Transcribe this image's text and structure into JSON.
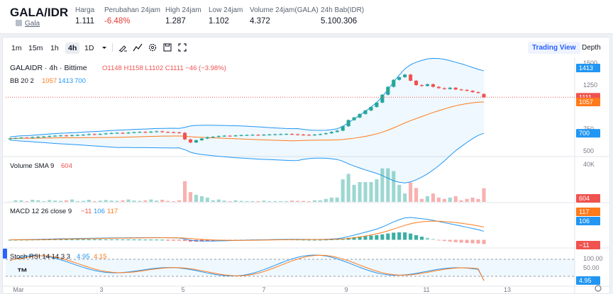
{
  "header": {
    "pair": "GALA/IDR",
    "coin_link": "Gala",
    "stats": [
      {
        "label": "Harga",
        "value": "1.111",
        "neg": false
      },
      {
        "label": "Perubahan 24jam",
        "value": "-6.48%",
        "neg": true
      },
      {
        "label": "High 24jam",
        "value": "1.287",
        "neg": false
      },
      {
        "label": "Low 24jam",
        "value": "1.102",
        "neg": false
      },
      {
        "label": "Volume 24jam(GALA)",
        "value": "4.372",
        "neg": false
      },
      {
        "label": "24h Bab(IDR)",
        "value": "5.100.306",
        "neg": false
      }
    ]
  },
  "toolbar": {
    "timeframes": [
      "1m",
      "15m",
      "1h",
      "4h",
      "1D"
    ],
    "active_timeframe": "4h",
    "icons": [
      "dropdown-icon",
      "draw-icon",
      "indicators-icon",
      "settings-icon",
      "save-icon",
      "fullscreen-icon"
    ],
    "tabs": [
      "Trading View",
      "Depth"
    ],
    "active_tab": "Trading View"
  },
  "legend": {
    "symbol": "GALAIDR · 4h · Bittime",
    "ohlc": "O1148 H1158 L1102 C1111 −46 (−3.98%)",
    "bb_label": "BB 20 2",
    "bb_values": [
      "1057",
      "1413",
      "700"
    ],
    "volume_label": "Volume SMA 9",
    "volume_value": "604",
    "macd_label": "MACD 12 26 close 9",
    "macd_values": [
      "−11",
      "106",
      "117"
    ],
    "stoch_label": "Stoch RSI 14 14 3 3",
    "stoch_values": [
      "4.95",
      "4.15"
    ]
  },
  "axes": {
    "price_ticks": [
      "1500",
      "1250",
      "750",
      "500"
    ],
    "price_badges": [
      {
        "text": "1413",
        "color": "#2196f3"
      },
      {
        "text": "1111",
        "color": "#ef5350"
      },
      {
        "text": "1057",
        "color": "#ff7a1a"
      },
      {
        "text": "700",
        "color": "#2196f3"
      }
    ],
    "volume_ticks": [
      "40K"
    ],
    "volume_badge": "604",
    "macd_badges": [
      {
        "text": "117",
        "color": "#ff7a1a"
      },
      {
        "text": "106",
        "color": "#2196f3"
      },
      {
        "text": "−11",
        "color": "#ef5350"
      }
    ],
    "stoch_ticks": [
      "100.00",
      "50.00"
    ],
    "stoch_badge": "4.95",
    "time_ticks": [
      "Mar",
      "3",
      "5",
      "7",
      "9",
      "11",
      "13"
    ]
  },
  "colors": {
    "up": "#26a69a",
    "down": "#ef5350",
    "bb_mid": "#ff7a1a",
    "bb_band": "#2196f3",
    "stoch_k": "#2196f3",
    "stoch_d": "#ff7a1a"
  },
  "chart_data": {
    "type": "candlestick",
    "symbol": "GALAIDR",
    "interval": "4h",
    "last_candle": {
      "open": 1148,
      "high": 1158,
      "low": 1102,
      "close": 1111,
      "change": -46,
      "change_pct": -3.98
    },
    "closes": [
      640,
      645,
      650,
      648,
      655,
      660,
      662,
      668,
      672,
      675,
      670,
      678,
      680,
      683,
      690,
      688,
      692,
      698,
      702,
      705,
      700,
      708,
      712,
      715,
      710,
      718,
      722,
      715,
      712,
      710,
      705,
      630,
      595,
      620,
      640,
      655,
      660,
      668,
      672,
      670,
      675,
      678,
      680,
      682,
      680,
      684,
      686,
      688,
      690,
      692,
      688,
      685,
      682,
      680,
      685,
      690,
      700,
      715,
      730,
      780,
      850,
      880,
      920,
      960,
      1000,
      1050,
      1140,
      1230,
      1310,
      1340,
      1370,
      1300,
      1250,
      1240,
      1260,
      1230,
      1215,
      1205,
      1220,
      1200,
      1195,
      1185,
      1170,
      1160,
      1111
    ],
    "bb_mid_last": 1057,
    "bb_upper_last": 1413,
    "bb_lower_last": 700,
    "volume_sma_last": 604,
    "macd": {
      "macd": 106,
      "signal": 117,
      "histogram": -11
    },
    "stoch_rsi": {
      "k": 4.95,
      "d": 4.15
    },
    "price_ylim": [
      450,
      1550
    ],
    "x_ticks": [
      "Mar",
      "3",
      "5",
      "7",
      "9",
      "11",
      "13"
    ]
  }
}
